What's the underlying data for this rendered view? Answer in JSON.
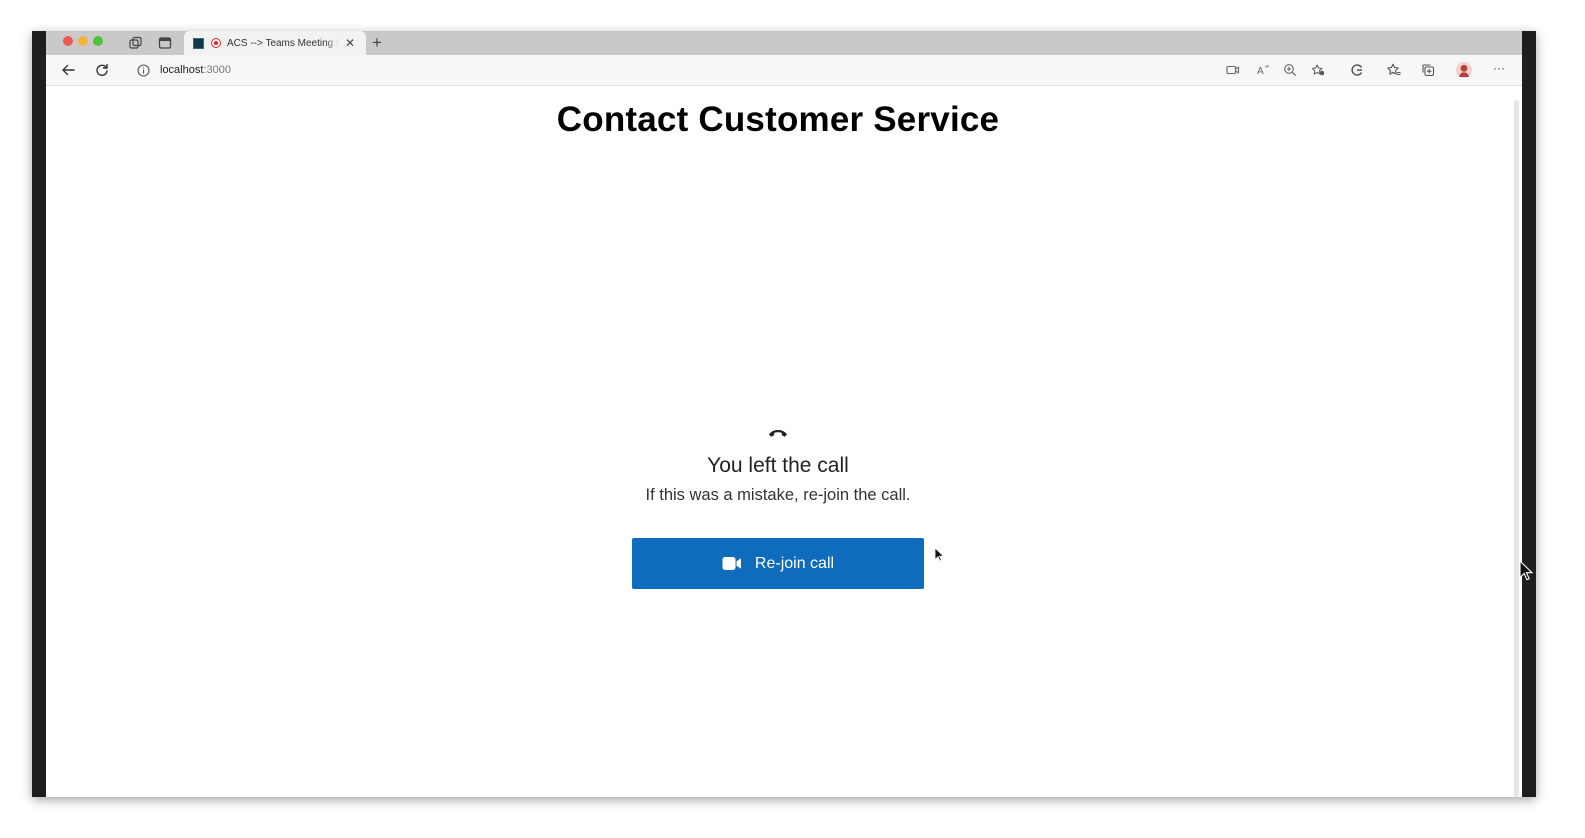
{
  "browser": {
    "tab": {
      "title": "ACS --> Teams Meeting D",
      "close": "✕"
    },
    "new_tab": "+",
    "address": {
      "host": "localhost",
      "port": ":3000"
    },
    "more": "···"
  },
  "page": {
    "title": "Contact Customer Service"
  },
  "call_ended": {
    "title": "You left the call",
    "message": "If this was a mistake, re-join the call.",
    "rejoin_label": "Re-join call"
  },
  "colors": {
    "accent": "#0f6cbd"
  },
  "icons": [
    "workspaces-icon",
    "tab-actions-icon",
    "back-arrow-icon",
    "refresh-icon",
    "info-icon",
    "camera-icon",
    "read-aloud-icon",
    "zoom-icon",
    "favorite-add-icon",
    "extensions-icon",
    "favorites-icon",
    "collections-icon",
    "profile-avatar",
    "hang-up-icon",
    "video-camera-icon"
  ]
}
